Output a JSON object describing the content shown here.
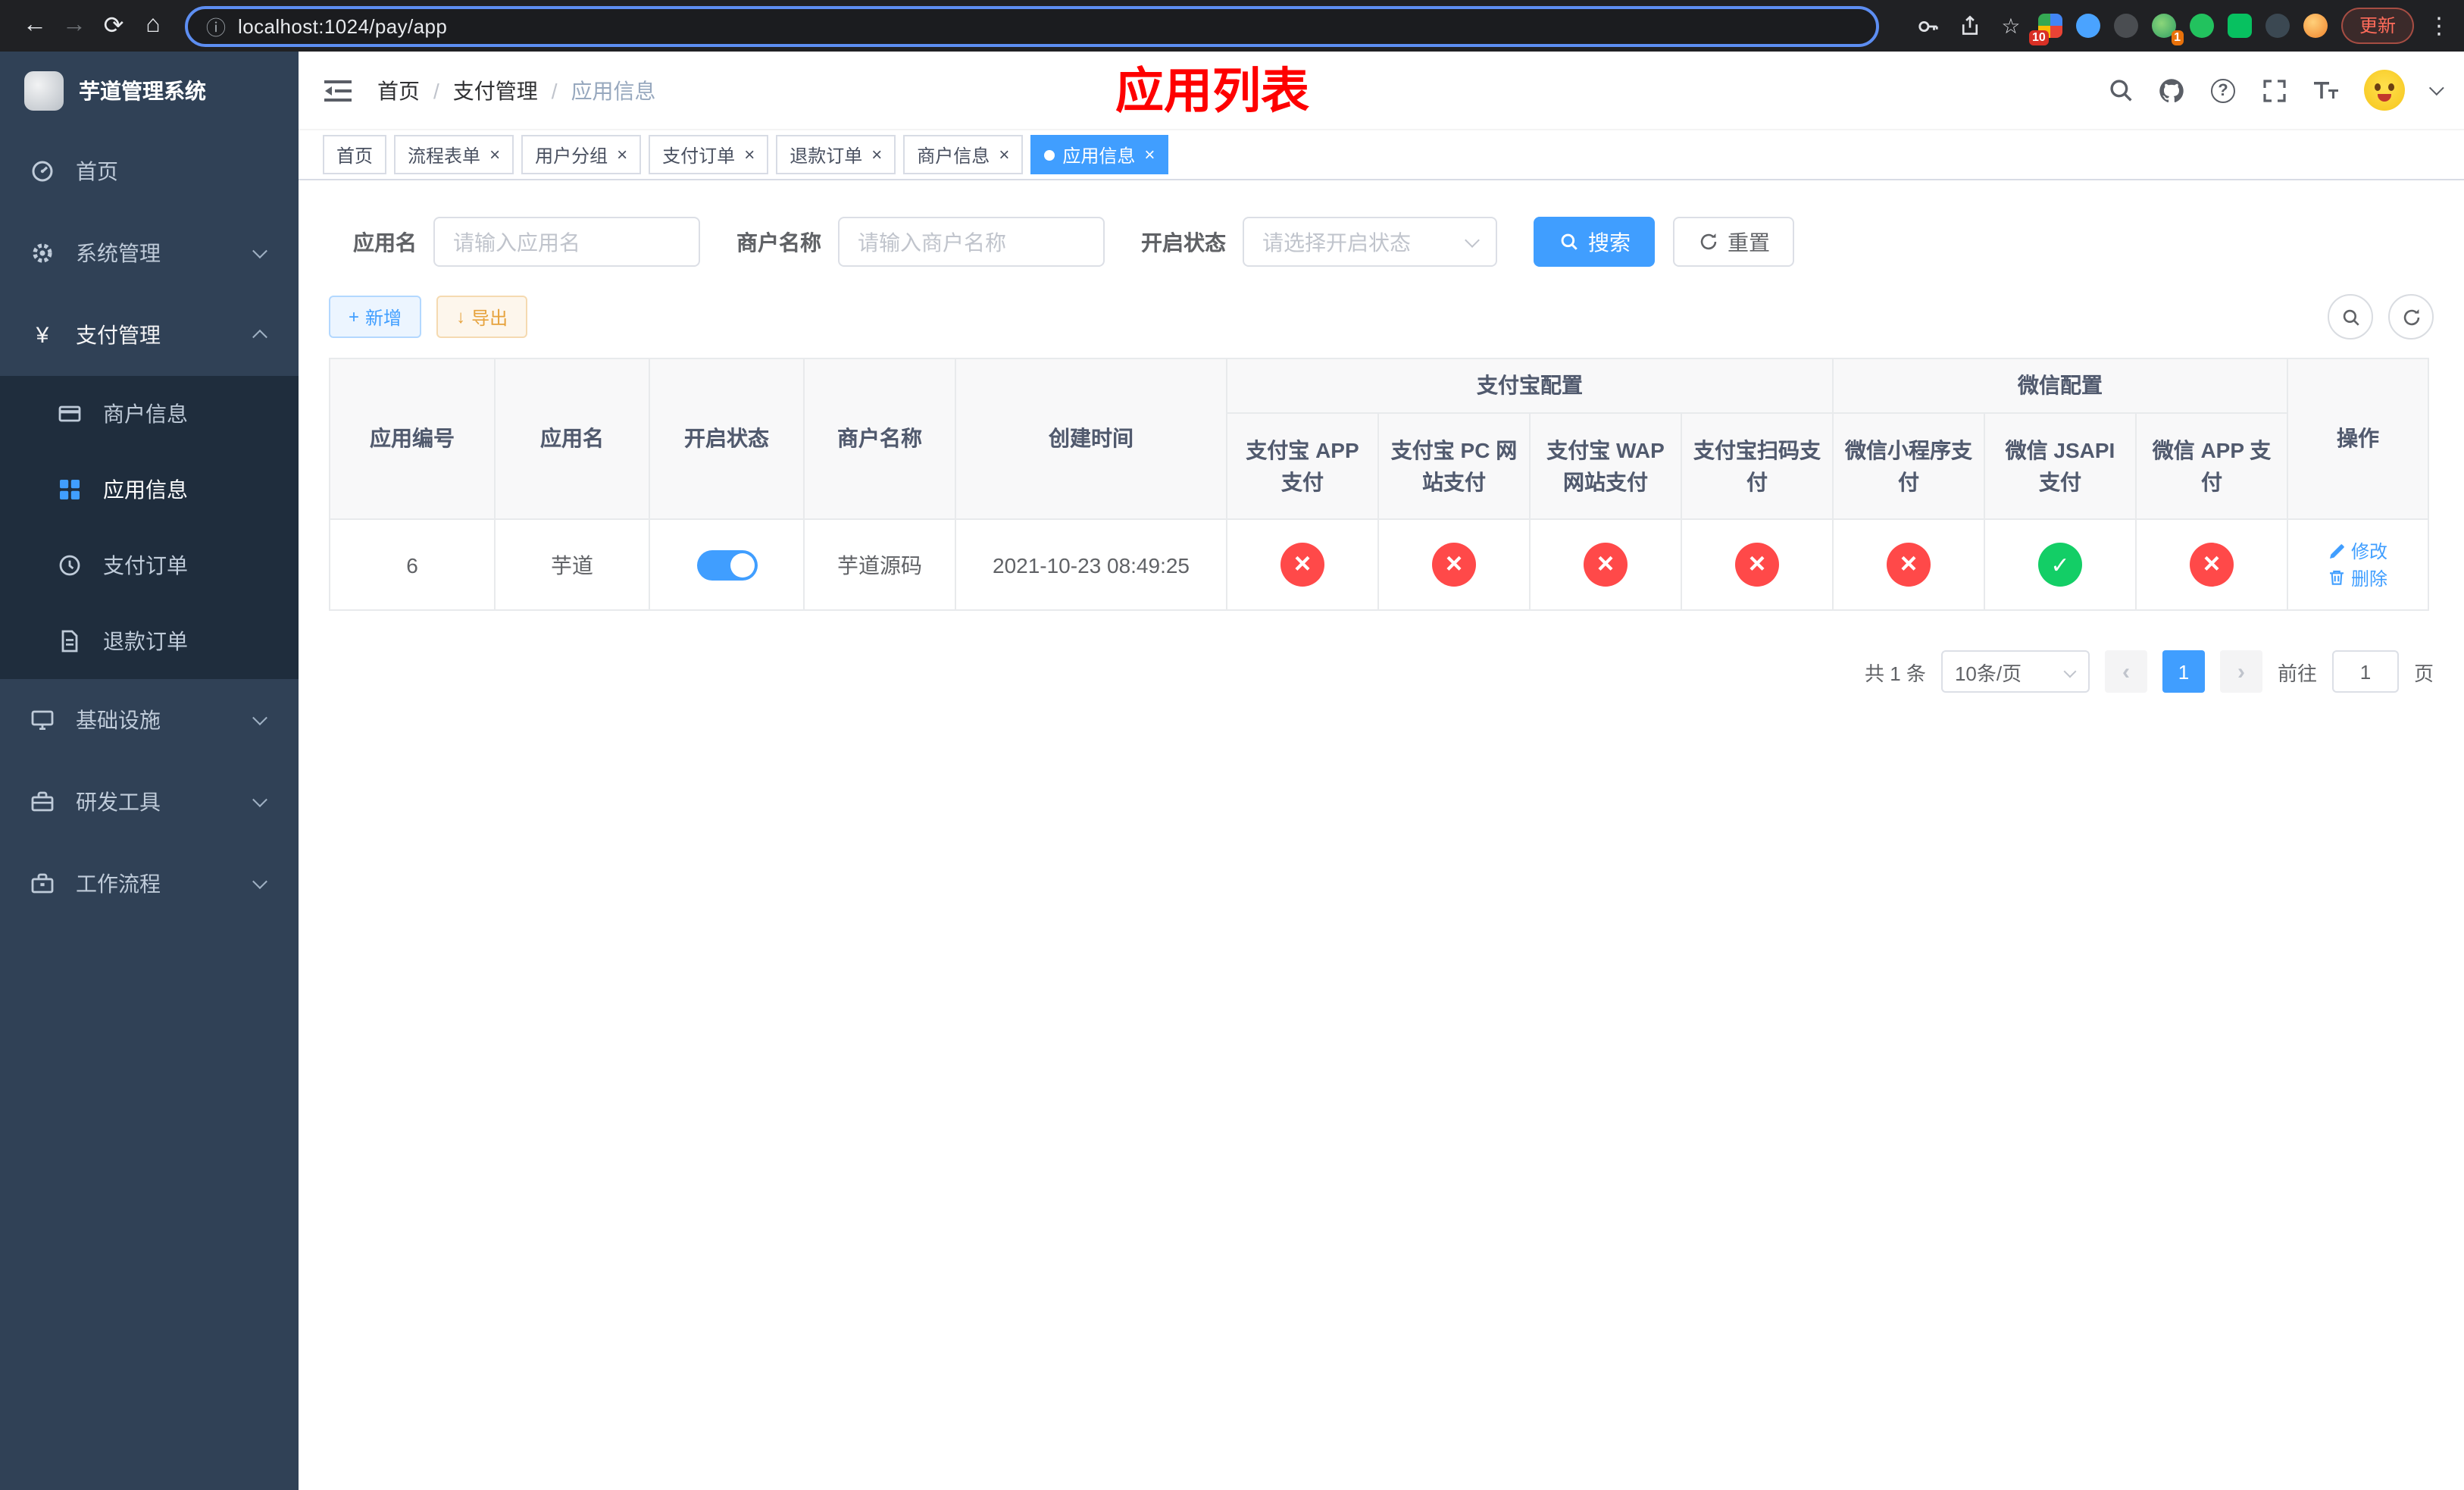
{
  "browser": {
    "url": "localhost:1024/pay/app",
    "update_label": "更新",
    "extension_badge_count": "10",
    "extension_badge_count2": "1"
  },
  "icons": {
    "back": "←",
    "forward": "→",
    "reload": "⟳",
    "home": "⌂",
    "info": "ⓘ",
    "star": "☆",
    "more": "⋮",
    "help": "?",
    "prev": "‹",
    "next": "›",
    "plus": "+",
    "download": "↓",
    "yuan": "¥"
  },
  "sidebar": {
    "title": "芋道管理系统",
    "items": [
      {
        "label": "首页"
      },
      {
        "label": "系统管理"
      },
      {
        "label": "支付管理",
        "expanded": true
      },
      {
        "label": "基础设施"
      },
      {
        "label": "研发工具"
      },
      {
        "label": "工作流程"
      }
    ],
    "submenu": [
      {
        "label": "商户信息"
      },
      {
        "label": "应用信息",
        "active": true
      },
      {
        "label": "支付订单"
      },
      {
        "label": "退款订单"
      }
    ]
  },
  "header": {
    "breadcrumb": [
      "首页",
      "支付管理",
      "应用信息"
    ],
    "annotation": "应用列表"
  },
  "tabs": [
    {
      "label": "首页",
      "closable": false,
      "active": false
    },
    {
      "label": "流程表单",
      "closable": true,
      "active": false
    },
    {
      "label": "用户分组",
      "closable": true,
      "active": false
    },
    {
      "label": "支付订单",
      "closable": true,
      "active": false
    },
    {
      "label": "退款订单",
      "closable": true,
      "active": false
    },
    {
      "label": "商户信息",
      "closable": true,
      "active": false
    },
    {
      "label": "应用信息",
      "closable": true,
      "active": true
    }
  ],
  "filters": {
    "app_name_label": "应用名",
    "app_name_placeholder": "请输入应用名",
    "merchant_label": "商户名称",
    "merchant_placeholder": "请输入商户名称",
    "status_label": "开启状态",
    "status_placeholder": "请选择开启状态",
    "search_label": "搜索",
    "reset_label": "重置"
  },
  "toolbar": {
    "add_label": "新增",
    "export_label": "导出"
  },
  "table": {
    "headers": {
      "id": "应用编号",
      "name": "应用名",
      "status": "开启状态",
      "merchant": "商户名称",
      "created": "创建时间",
      "alipay_group": "支付宝配置",
      "wechat_group": "微信配置",
      "alipay_app": "支付宝 APP 支付",
      "alipay_pc": "支付宝 PC 网站支付",
      "alipay_wap": "支付宝 WAP 网站支付",
      "alipay_qr": "支付宝扫码支付",
      "wx_lite": "微信小程序支付",
      "wx_jsapi": "微信 JSAPI 支付",
      "wx_app": "微信 APP 支付",
      "actions": "操作"
    },
    "rows": [
      {
        "id": "6",
        "name": "芋道",
        "enabled": true,
        "merchant": "芋道源码",
        "created": "2021-10-23 08:49:25",
        "alipay_app": false,
        "alipay_pc": false,
        "alipay_wap": false,
        "alipay_qr": false,
        "wx_lite": false,
        "wx_jsapi": true,
        "wx_app": false,
        "edit_label": "修改",
        "delete_label": "删除"
      }
    ]
  },
  "pagination": {
    "total": "共 1 条",
    "page_size": "10条/页",
    "page": "1",
    "goto_label": "前往",
    "goto_value": "1",
    "page_unit": "页"
  },
  "colors": {
    "accent": "#409EFF",
    "success": "#13ce66",
    "danger": "#ff4949",
    "warning": "#e6a23c",
    "sidebar_bg": "#304156",
    "submenu_bg": "#1f2d3d",
    "annotation": "#ff0000"
  }
}
